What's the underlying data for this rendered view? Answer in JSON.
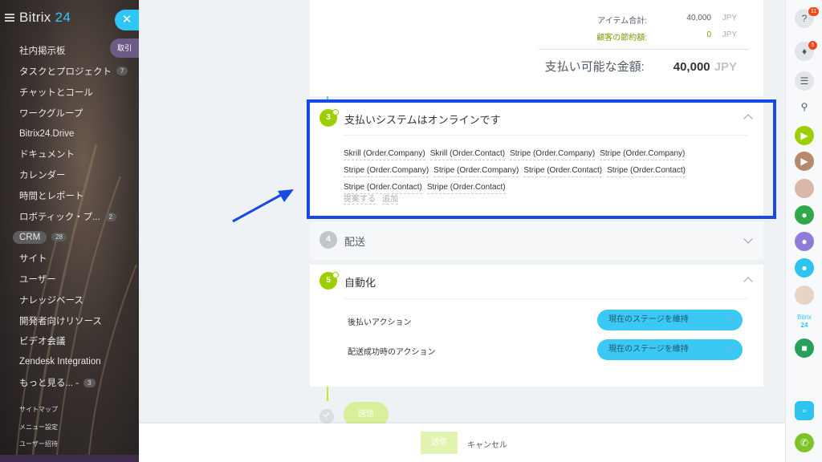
{
  "sidebar": {
    "logo_main": "Bitrix",
    "logo_num": "24",
    "tag": "取引",
    "items": [
      {
        "label": "社内掲示板"
      },
      {
        "label": "タスクとプロジェクト",
        "badge": "7"
      },
      {
        "label": "チャットとコール"
      },
      {
        "label": "ワークグループ"
      },
      {
        "label": "Bitrix24.Drive"
      },
      {
        "label": "ドキュメント"
      },
      {
        "label": "カレンダー"
      },
      {
        "label": "時間とレポート"
      },
      {
        "label": "ロボティック・プ...",
        "badge": "2"
      },
      {
        "label": "CRM",
        "badge": "28"
      },
      {
        "label": "サイト"
      },
      {
        "label": "ユーザー"
      },
      {
        "label": "ナレッジベース"
      },
      {
        "label": "開発者向けリソース"
      },
      {
        "label": "ビデオ会議"
      },
      {
        "label": "Zendesk Integration"
      },
      {
        "label": "もっと見る... -",
        "badge": "3"
      }
    ],
    "small_items": [
      "サイトマップ",
      "メニュー設定",
      "ユーザー招待"
    ]
  },
  "totals": {
    "items_total_label": "アイテム合計:",
    "items_total_value": "40,000",
    "savings_label": "顧客の節約額:",
    "savings_value": "0",
    "currency": "JPY",
    "payable_label": "支払い可能な金額:",
    "payable_value": "40,000",
    "payable_currency": "JPY"
  },
  "payment": {
    "step": "3",
    "title": "支払いシステムはオンラインです",
    "systems": [
      "Skrill (Order.Company)",
      "Skrill (Order.Contact)",
      "Stripe (Order.Company)",
      "Stripe (Order.Company)",
      "Stripe (Order.Company)",
      "Stripe (Order.Company)",
      "Stripe (Order.Contact)",
      "Stripe (Order.Contact)",
      "Stripe (Order.Contact)",
      "Stripe (Order.Contact)"
    ],
    "suggest_link": "提案する",
    "add_link": "追加"
  },
  "delivery": {
    "step": "4",
    "title": "配送"
  },
  "automation": {
    "step": "5",
    "title": "自動化",
    "rows": [
      {
        "label": "後払いアクション",
        "value": "現在のステージを維持"
      },
      {
        "label": "配送成功時のアクション",
        "value": "現在のステージを維持"
      }
    ]
  },
  "submit_pill": "送信",
  "footer": {
    "send": "送信",
    "cancel": "キャンセル"
  },
  "rightbar": {
    "help_badge": "11",
    "notif_badge": "5",
    "logo_main": "Bitrix",
    "logo_num": "24"
  },
  "colors": {
    "accent": "#2fc6f6",
    "green": "#9dcf00",
    "highlight": "#1649e5"
  }
}
